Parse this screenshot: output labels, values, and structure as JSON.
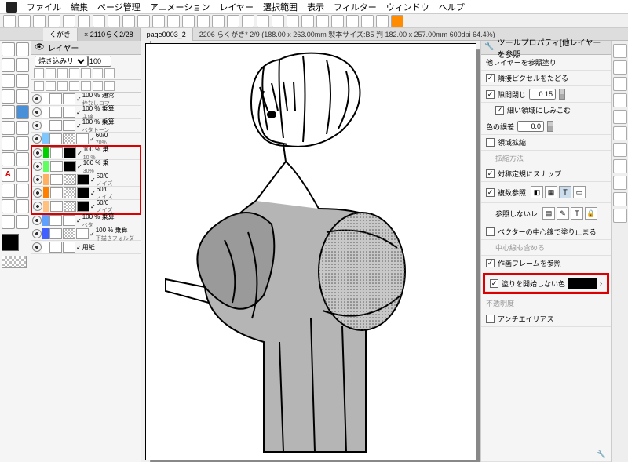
{
  "menu": [
    "ファイル",
    "編集",
    "ページ管理",
    "アニメーション",
    "レイヤー",
    "選択範囲",
    "表示",
    "フィルター",
    "ウィンドウ",
    "ヘルプ"
  ],
  "tabs": [
    {
      "label": "くがき",
      "cls": ""
    },
    {
      "label": "× 2110らく2/28",
      "cls": "grey"
    },
    {
      "label": "page0003_2",
      "cls": ""
    }
  ],
  "doc_info": "2206 らくがき* 2/9 (188.00 x 263.00mm 製本サイズ:B5 判 182.00 x 257.00mm 600dpi 64.4%)",
  "layer_panel": {
    "title": "レイヤー",
    "blend": "焼き込みリ",
    "opacity": "100"
  },
  "layers": [
    {
      "color": "#fff",
      "name": "100 % 通常",
      "sub": "枠なしコマ"
    },
    {
      "color": "#fff",
      "name": "100 % 乗算",
      "sub": "主線"
    },
    {
      "color": "#fff",
      "name": "100 % 乗算",
      "sub": "ベタトーン"
    },
    {
      "color": "#7fc8ff",
      "name": "60/0",
      "sub": "70%",
      "check": true
    },
    {
      "color": "#00d000",
      "name": "100 % 乗",
      "sub": "10 %",
      "hl": true,
      "black": true
    },
    {
      "color": "#60ff60",
      "name": "100 % 乗",
      "sub": "30%",
      "hl": true,
      "black": true
    },
    {
      "color": "#ffb060",
      "name": "50/0",
      "sub": "ノイズ",
      "hl": true,
      "black": true,
      "check": true
    },
    {
      "color": "#ff8000",
      "name": "60/0",
      "sub": "ノイズ",
      "hl": true,
      "black": true,
      "check": true
    },
    {
      "color": "#ffc080",
      "name": "60/0",
      "sub": "ノイズ",
      "hl": true,
      "black": true,
      "check": true
    },
    {
      "color": "#60a0ff",
      "name": "100 % 乗算",
      "sub": "ベタ"
    },
    {
      "color": "#4060ff",
      "name": "100 % 乗算",
      "sub": "下描きフォルダー",
      "check": true
    },
    {
      "color": "#fff",
      "name": "用紙",
      "sub": ""
    }
  ],
  "props": {
    "header": "ツールプロパティ[他レイヤーを参照",
    "title": "他レイヤーを参照塗り",
    "p1": "隣接ピクセルをたどる",
    "p2": "隙間閉じ",
    "p2v": "0.15",
    "p3": "細い領域にしみこむ",
    "p4": "色の誤差",
    "p4v": "0.0",
    "p5": "領域拡縮",
    "p5b": "拡縮方法",
    "p6": "対称定規にスナップ",
    "p7": "複数参照",
    "p7b": "参照しないレ",
    "p8": "ベクターの中心線で塗り止まる",
    "p8b": "中心線も含める",
    "p9": "作画フレームを参照",
    "p10": "塗りを開始しない色",
    "p11": "不透明度",
    "p12": "アンチエイリアス"
  }
}
